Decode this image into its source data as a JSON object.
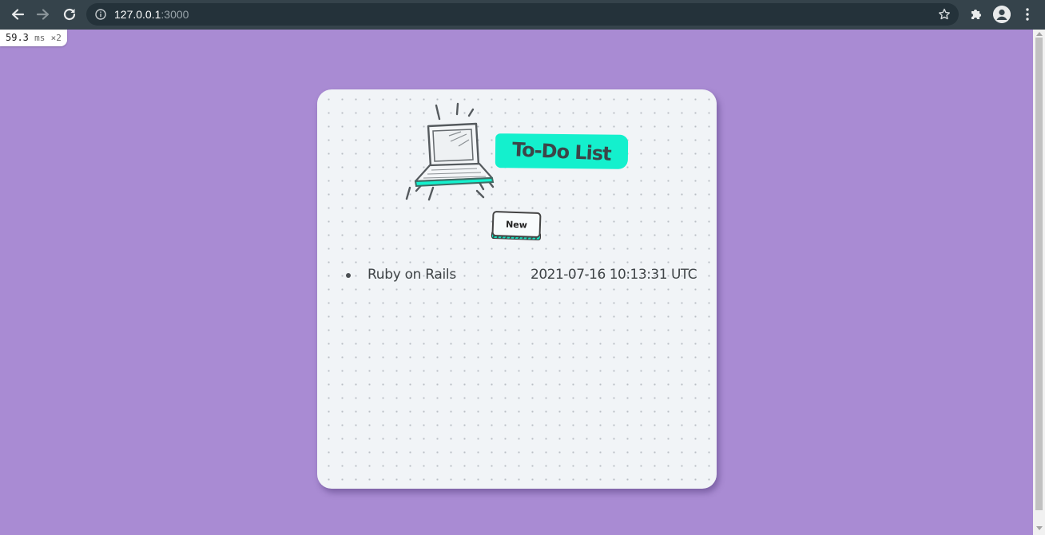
{
  "browser": {
    "url_host": "127.0.0.1",
    "url_port": ":3000",
    "icons": {
      "back": "back-arrow-icon",
      "forward": "forward-arrow-icon",
      "reload": "reload-icon",
      "info": "info-icon",
      "bookmark": "star-icon",
      "extensions": "puzzle-icon",
      "profile": "profile-icon",
      "menu": "kebab-menu-icon"
    }
  },
  "perf_badge": {
    "value": "59.3",
    "unit": "ms",
    "multiplier": "×2"
  },
  "page": {
    "title": "To-Do List",
    "new_button_label": "New",
    "illustration": "laptop-icon",
    "todos": [
      {
        "name": "Ruby on Rails",
        "created_at": "2021-07-16 10:13:31 UTC"
      }
    ]
  },
  "colors": {
    "page_background": "#a98bd3",
    "card_background": "#f1f4f7",
    "accent": "#14f0cd",
    "text": "#3f4447",
    "chrome": "#35434b"
  }
}
